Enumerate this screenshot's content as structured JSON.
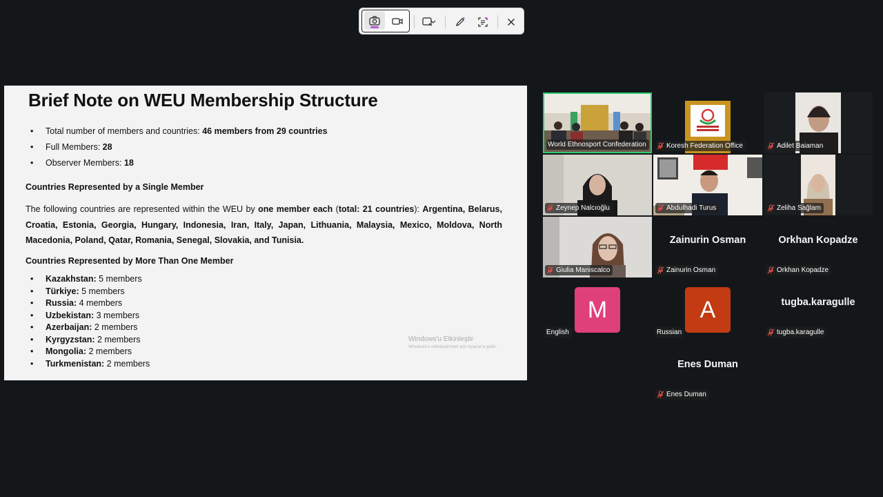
{
  "slide": {
    "title": "Brief Note on WEU Membership Structure",
    "summary": [
      {
        "label": "Total number of members and countries: ",
        "value": "46 members from 29 countries"
      },
      {
        "label": "Full Members: ",
        "value": "28"
      },
      {
        "label": "Observer Members: ",
        "value": "18"
      }
    ],
    "single_heading": "Countries Represented by a Single Member",
    "single_para": {
      "intro": "The following countries are represented within the WEU by ",
      "bold1": "one member each",
      "mid1": " (",
      "bold2": "total: 21 countries",
      "mid2": "): ",
      "countries": "Argentina, Belarus, Croatia, Estonia, Georgia, Hungary, Indonesia, Iran, Italy, Japan, Lithuania, Malaysia, Mexico, Moldova, North Macedonia, Poland, Qatar, Romania, Senegal, Slovakia, and Tunisia."
    },
    "multi_heading": "Countries Represented by More Than One Member",
    "multi": [
      {
        "country": "Kazakhstan:",
        "count": " 5 members"
      },
      {
        "country": "Türkiye:",
        "count": " 5 members"
      },
      {
        "country": "Russia:",
        "count": " 4 members"
      },
      {
        "country": "Uzbekistan:",
        "count": " 3 members"
      },
      {
        "country": "Azerbaijan:",
        "count": " 2 members"
      },
      {
        "country": "Kyrgyzstan:",
        "count": " 2 members"
      },
      {
        "country": "Mongolia:",
        "count": " 2 members"
      },
      {
        "country": "Turkmenistan:",
        "count": " 2 members"
      }
    ],
    "watermark_title": "Windows'u Etkinleştir",
    "watermark_sub": "Windows'u etkinleştirmek için Ayarlar'a gidin."
  },
  "participants": [
    {
      "name": "World Ethnosport Confederation",
      "muted": false,
      "speaking": true,
      "type": "video"
    },
    {
      "name": "Koresh Federation Office",
      "muted": true,
      "type": "video"
    },
    {
      "name": "Adilet Baiaman",
      "muted": true,
      "type": "video"
    },
    {
      "name": "Zeynep Nalcıoğlu",
      "muted": true,
      "type": "video"
    },
    {
      "name": "Abdulhadi Turus",
      "muted": true,
      "type": "video"
    },
    {
      "name": "Zeliha Sağlam",
      "muted": true,
      "type": "video"
    },
    {
      "name": "Giulia Maniscalco",
      "muted": true,
      "type": "video"
    },
    {
      "name": "Zainurin Osman",
      "display": "Zainurin Osman",
      "muted": true,
      "type": "name"
    },
    {
      "name": "Orkhan Kopadze",
      "display": "Orkhan Kopadze",
      "muted": true,
      "type": "name"
    },
    {
      "name": "English",
      "initial": "M",
      "color": "#e0407a",
      "muted": false,
      "type": "avatar"
    },
    {
      "name": "Russian",
      "initial": "A",
      "color": "#c23b12",
      "muted": false,
      "type": "avatar"
    },
    {
      "name": "tugba.karagulle",
      "display": "tugba.karagulle",
      "muted": true,
      "type": "name"
    },
    {
      "name": "Enes Duman",
      "display": "Enes Duman",
      "muted": true,
      "type": "name"
    }
  ],
  "colors": {
    "speaking_border": "#2ecc71",
    "muted_icon": "#e8504a",
    "record_accent": "#b35cd6"
  }
}
